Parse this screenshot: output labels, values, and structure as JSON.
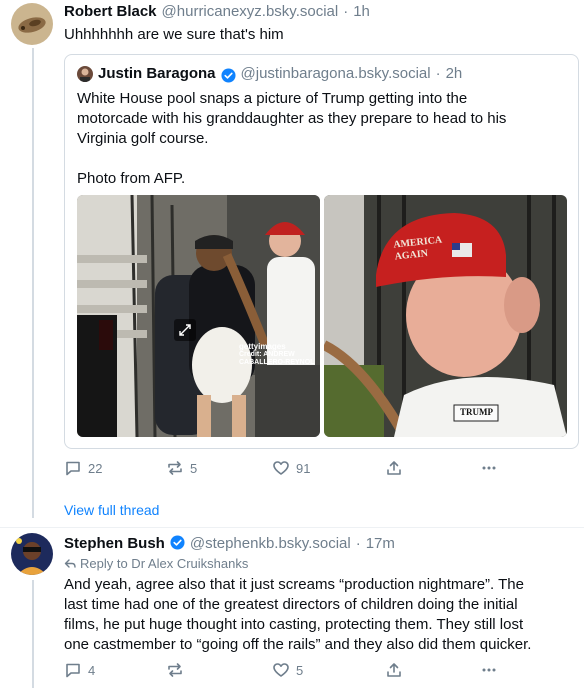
{
  "post1": {
    "display_name": "Robert Black",
    "handle": "@hurricanexyz.bsky.social",
    "separator": "·",
    "time": "1h",
    "text": "Uhhhhhhh are we sure that's him",
    "quote": {
      "display_name": "Justin Baragona",
      "handle": "@justinbaragona.bsky.social",
      "separator": "·",
      "time": "2h",
      "text_line1": "White House pool snaps a picture of Trump getting into the",
      "text_line2": "motorcade with his granddaughter as they prepare to head to his",
      "text_line3": "Virginia golf course.",
      "text_line4": "Photo from AFP.",
      "image1_watermark_brand": "gettyimages",
      "image1_watermark_credit1": "Credit: ANDREW",
      "image1_watermark_credit2": "CABALLERO-REYNOL",
      "image2_hat_text1": "AMERICA",
      "image2_hat_text2": "AGAIN",
      "image2_shirt_text": "TRUMP"
    },
    "actions": {
      "replies": "22",
      "reposts": "5",
      "likes": "91"
    },
    "view_thread": "View full thread"
  },
  "post2": {
    "display_name": "Stephen Bush",
    "handle": "@stephenkb.bsky.social",
    "separator": "·",
    "time": "17m",
    "reply_to": "Reply to Dr Alex Cruikshanks",
    "text_line1": "And yeah, agree also that it just screams “production nightmare”. The",
    "text_line2": "last time had one of the greatest directors of children doing the initial",
    "text_line3": "films, he put huge thought into casting, protecting them. They still lost",
    "text_line4": "one castmember to “going off the rails”  and they also did them quicker.",
    "actions": {
      "replies": "4",
      "reposts": "",
      "likes": "5"
    }
  },
  "colors": {
    "text": "#0b0f14",
    "muted": "#6f7e8c",
    "link": "#1083fe",
    "border": "#d4dbe2",
    "verified": "#1083fe"
  },
  "icons": [
    "reply-icon",
    "repost-icon",
    "like-icon",
    "share-icon",
    "more-icon",
    "verified-icon",
    "reply-arrow-icon",
    "expand-icon"
  ]
}
